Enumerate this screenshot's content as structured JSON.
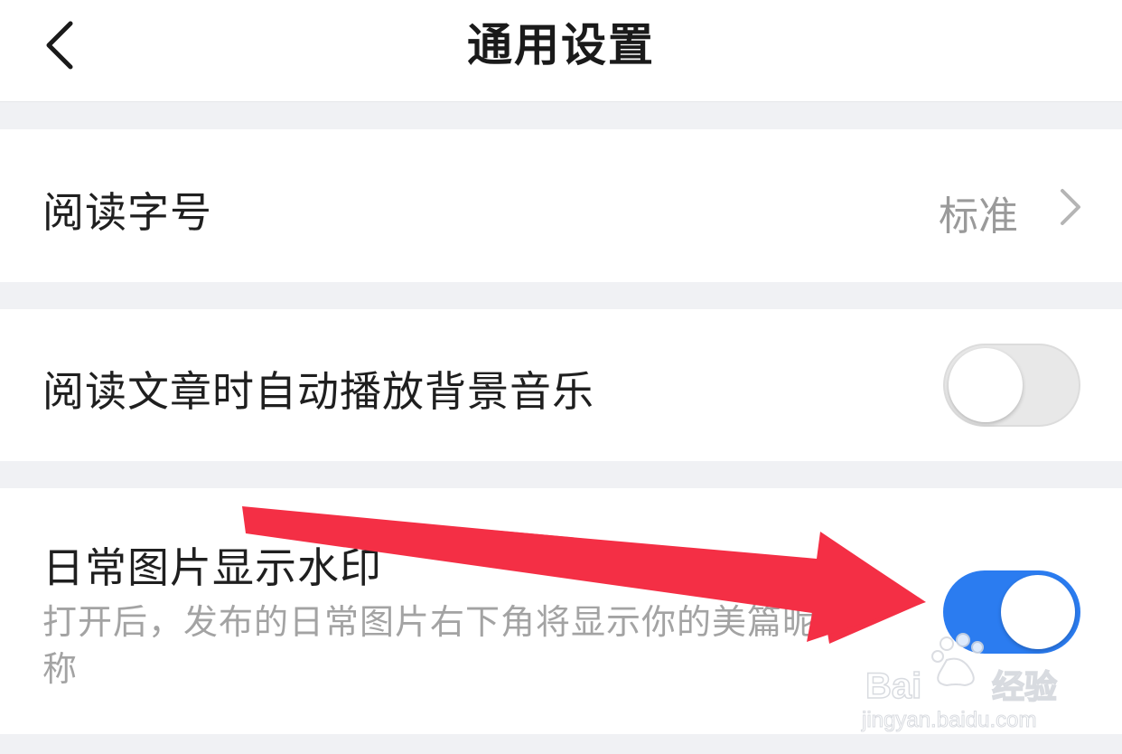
{
  "header": {
    "title": "通用设置"
  },
  "settings": {
    "font_size": {
      "label": "阅读字号",
      "value": "标准"
    },
    "auto_music": {
      "label": "阅读文章时自动播放背景音乐",
      "enabled": false
    },
    "watermark": {
      "label": "日常图片显示水印",
      "description": "打开后，发布的日常图片右下角将显示你的美篇昵称",
      "enabled": true
    }
  },
  "colors": {
    "accent": "#2b7cf0",
    "annotation_arrow": "#f42f45",
    "background": "#f0f1f4"
  },
  "icons": {
    "back": "chevron-left-icon",
    "forward": "chevron-right-icon"
  },
  "overlay": {
    "watermark_brand": "Baidu经验",
    "watermark_url": "jingyan.baidu.com"
  }
}
